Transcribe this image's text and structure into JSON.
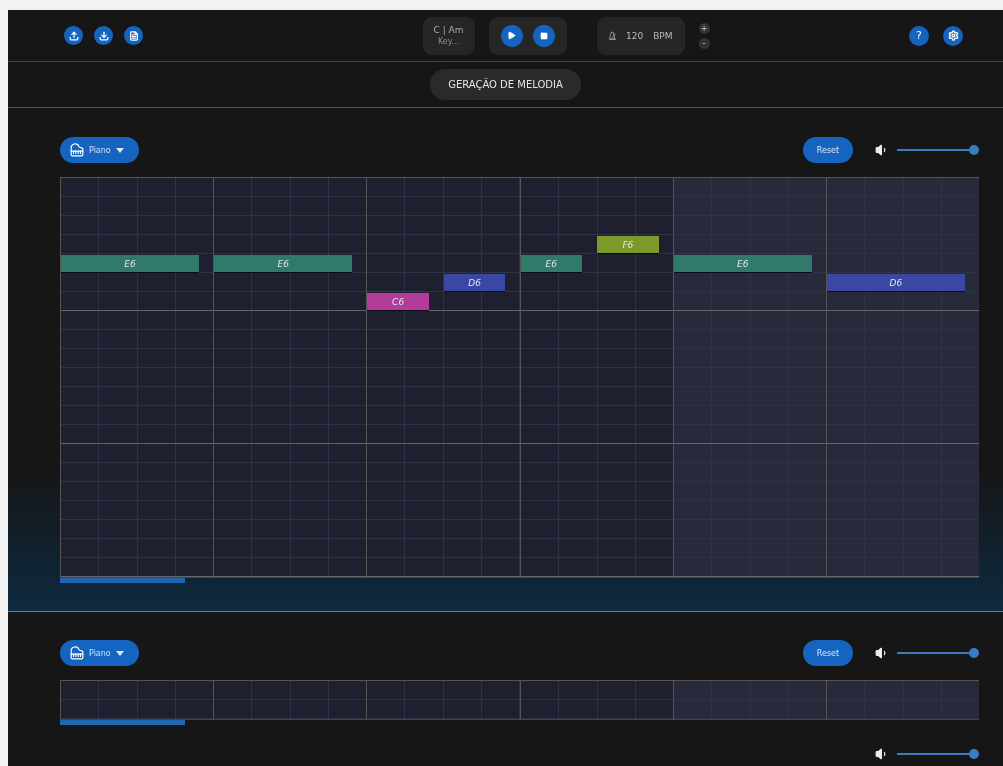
{
  "header": {
    "key": {
      "value": "C | Am",
      "hint": "Key..."
    },
    "tempo": {
      "value": "120",
      "unit": "BPM"
    },
    "tempo_steps": [
      "+",
      "-"
    ],
    "help": "?"
  },
  "mode_tab": {
    "label": "GERAÇÃO DE MELODIA",
    "selected": true
  },
  "tracks": [
    {
      "kind": "piano_roll",
      "instrument": "Piano",
      "reset": "Reset",
      "volume": {
        "level": 1
      },
      "notes": [
        {
          "label": "E6",
          "color": "#31796a"
        },
        {
          "label": "E6",
          "color": "#31796a"
        },
        {
          "label": "C6",
          "color": "#b23c97"
        },
        {
          "label": "D6",
          "color": "#3a47a3"
        },
        {
          "label": "E6",
          "color": "#31796a"
        },
        {
          "label": "F6",
          "color": "#7b9a2b"
        },
        {
          "label": "E6",
          "color": "#31796a"
        },
        {
          "label": "D6",
          "color": "#3a47a3"
        }
      ]
    },
    {
      "kind": "collapsed",
      "instrument": "Piano",
      "reset": "Reset",
      "volume": {
        "level": 1
      }
    }
  ],
  "master_volume": {
    "level": 1
  }
}
